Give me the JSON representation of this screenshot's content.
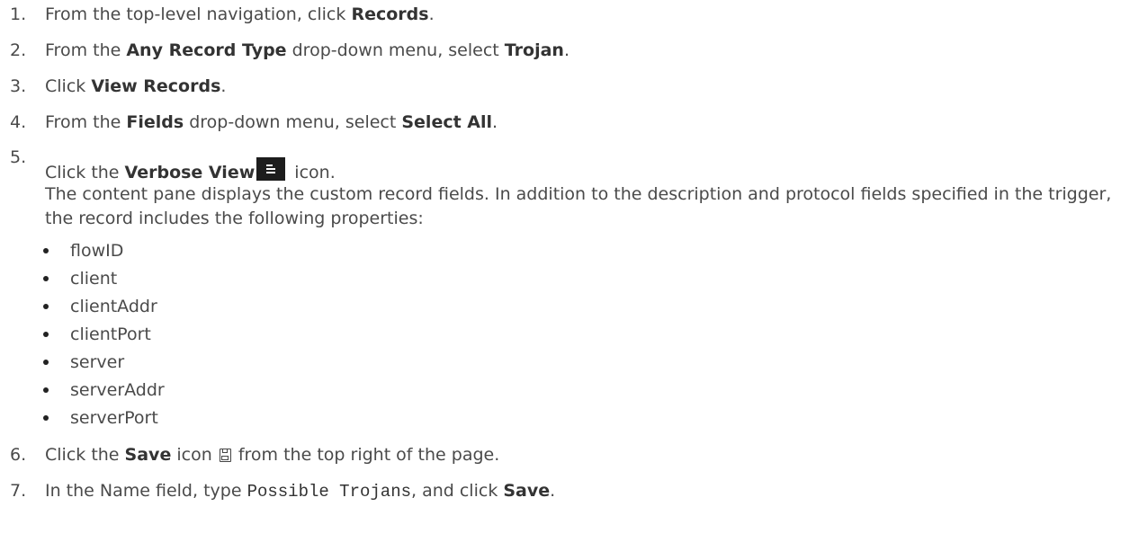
{
  "steps": [
    {
      "number": "1.",
      "pre": "From the top-level navigation, click ",
      "b1": "Records",
      "post": "."
    },
    {
      "number": "2.",
      "pre": "From the ",
      "b1": "Any Record Type",
      "mid": " drop-down menu, select ",
      "b2": "Trojan",
      "post": "."
    },
    {
      "number": "3.",
      "pre": "Click ",
      "b1": "View Records",
      "post": "."
    },
    {
      "number": "4.",
      "pre": "From the ",
      "b1": "Fields",
      "mid": " drop-down menu, select ",
      "b2": "Select All",
      "post": "."
    },
    {
      "number": "5.",
      "pre": "Click the ",
      "b1": "Verbose View",
      "post": " icon.",
      "icon": "verbose-view-icon",
      "description": "The content pane displays the custom record fields. In addition to the description and protocol fields specified in the trigger, the record includes the following properties:",
      "properties": [
        "flowID",
        "client",
        "clientAddr",
        "clientPort",
        "server",
        "serverAddr",
        "serverPort"
      ]
    },
    {
      "number": "6.",
      "pre": "Click the ",
      "b1": "Save",
      "mid": " icon ",
      "icon": "save-icon",
      "post": " from the top right of the page."
    },
    {
      "number": "7.",
      "pre": "In the Name field, type ",
      "code": "Possible Trojans",
      "mid": ", and click ",
      "b2": "Save",
      "post": "."
    }
  ]
}
